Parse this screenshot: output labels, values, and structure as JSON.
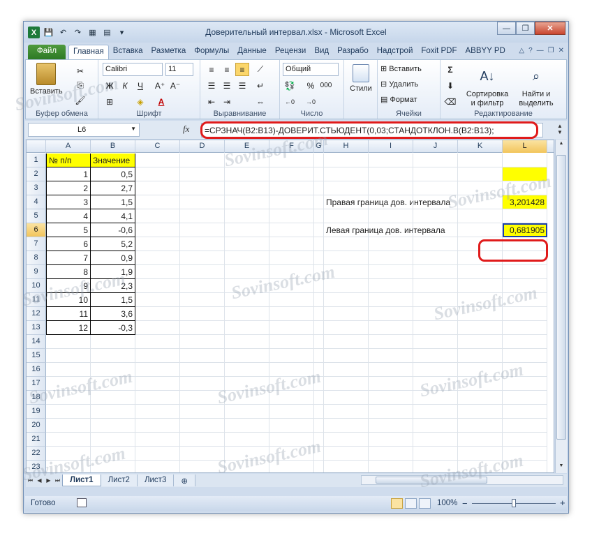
{
  "window": {
    "title": "Доверительный интервал.xlsx - Microsoft Excel"
  },
  "tabs": [
    "Файл",
    "Главная",
    "Вставка",
    "Разметка",
    "Формулы",
    "Данные",
    "Рецензи",
    "Вид",
    "Разрабо",
    "Надстрой",
    "Foxit PDF",
    "ABBYY PD"
  ],
  "ribbon": {
    "clipboard": {
      "paste": "Вставить",
      "label": "Буфер обмена"
    },
    "font": {
      "name": "Calibri",
      "size": "11",
      "bold": "Ж",
      "italic": "К",
      "underline": "Ч",
      "color_letter": "А",
      "label": "Шрифт"
    },
    "alignment": {
      "label": "Выравнивание"
    },
    "number": {
      "format": "Общий",
      "percent": "%",
      "thousands": "000",
      "label": "Число"
    },
    "styles": {
      "label": "Стили"
    },
    "cells": {
      "insert": "Вставить",
      "delete": "Удалить",
      "format": "Формат",
      "label": "Ячейки"
    },
    "editing": {
      "sort": "Сортировка\nи фильтр",
      "find": "Найти и\nвыделить",
      "label": "Редактирование"
    }
  },
  "formula_bar": {
    "cell_ref": "L6",
    "fx": "fx",
    "formula": "=СРЗНАЧ(B2:B13)-ДОВЕРИТ.СТЬЮДЕНТ(0,03;СТАНДОТКЛОН.В(B2:B13);"
  },
  "columns": [
    "A",
    "B",
    "C",
    "D",
    "E",
    "F",
    "G",
    "H",
    "I",
    "J",
    "K",
    "L"
  ],
  "rows": [
    "1",
    "2",
    "3",
    "4",
    "5",
    "6",
    "7",
    "8",
    "9",
    "10",
    "11",
    "12",
    "13",
    "14",
    "15",
    "16",
    "17",
    "18",
    "19",
    "20",
    "21",
    "22",
    "23"
  ],
  "cells": {
    "A1": "№ п/п",
    "B1": "Значение",
    "A": [
      "1",
      "2",
      "3",
      "4",
      "5",
      "6",
      "7",
      "8",
      "9",
      "10",
      "11",
      "12"
    ],
    "B": [
      "0,5",
      "2,7",
      "1,5",
      "4,1",
      "-0,6",
      "5,2",
      "0,9",
      "1,9",
      "2,3",
      "1,5",
      "3,6",
      "-0,3"
    ],
    "H4": "Правая граница дов. интервала",
    "L4": "3,201428",
    "H6": "Левая граница дов. интервала",
    "L6": "0,681905"
  },
  "sheets": [
    "Лист1",
    "Лист2",
    "Лист3"
  ],
  "status": {
    "ready": "Готово",
    "zoom": "100%",
    "minus": "−",
    "plus": "+"
  },
  "watermark": "Sovinsoft.com",
  "colors": {
    "highlight_yellow": "#ffff00",
    "annotation_red": "#e01b1b",
    "file_tab_green": "#2d7a25"
  }
}
